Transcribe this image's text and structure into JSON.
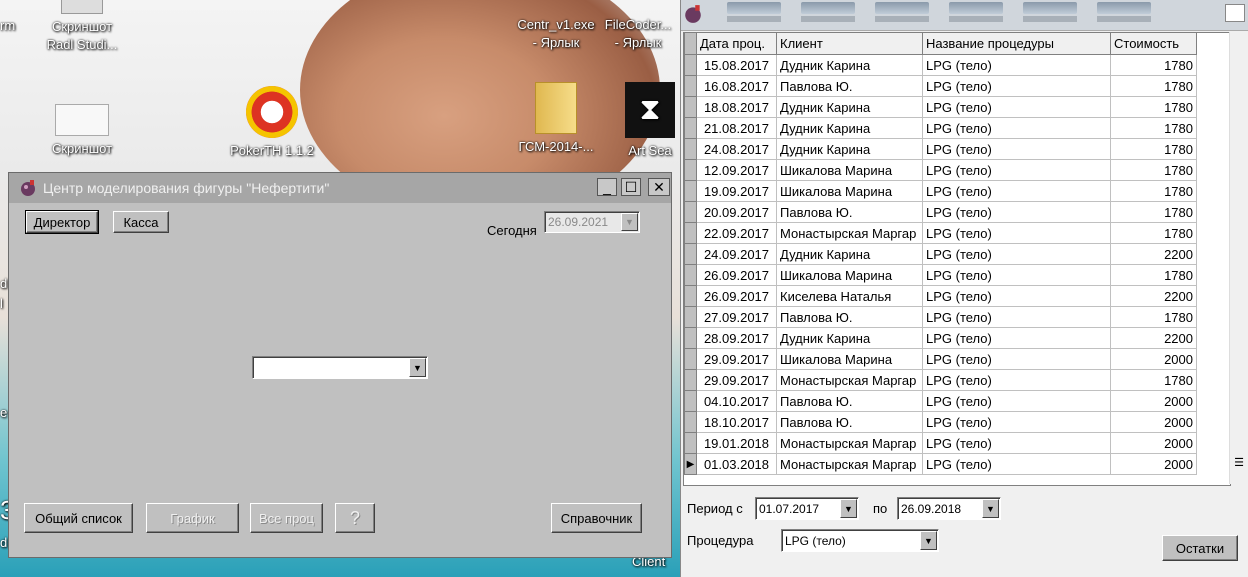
{
  "desktop": {
    "icons": [
      {
        "label": "Скриншот\nRadl Studi..."
      },
      {
        "label": "Скриншот"
      },
      {
        "label": "PokerTH 1.1.2"
      },
      {
        "label": "Centr_v1.exe\n- Ярлык"
      },
      {
        "label": "FileCoder...\n- Ярлык"
      },
      {
        "label": "ГСМ-2014-..."
      },
      {
        "label": "Art Sea"
      },
      {
        "label": "Client"
      }
    ],
    "edge_texts": [
      "rm",
      "d",
      "l",
      "3",
      "d",
      "e"
    ]
  },
  "main_window": {
    "title": "Центр моделирования фигуры \"Нефертити\"",
    "buttons": {
      "director": "Директор",
      "cash": "Касса",
      "general_list": "Общий список",
      "schedule": "График",
      "all_procs": "Все проц",
      "help": "?",
      "reference": "Справочник"
    },
    "today_label": "Сегодня",
    "today_value": "26.09.2021",
    "center_combo_value": ""
  },
  "table": {
    "headers": [
      "Дата проц.",
      "Клиент",
      "Название процедуры",
      "Стоимость"
    ],
    "rows": [
      [
        "15.08.2017",
        "Дудник Карина",
        "LPG (тело)",
        "1780"
      ],
      [
        "16.08.2017",
        "Павлова Ю.",
        "LPG (тело)",
        "1780"
      ],
      [
        "18.08.2017",
        "Дудник Карина",
        "LPG (тело)",
        "1780"
      ],
      [
        "21.08.2017",
        "Дудник Карина",
        "LPG (тело)",
        "1780"
      ],
      [
        "24.08.2017",
        "Дудник Карина",
        "LPG (тело)",
        "1780"
      ],
      [
        "12.09.2017",
        "Шикалова Марина",
        "LPG (тело)",
        "1780"
      ],
      [
        "19.09.2017",
        "Шикалова Марина",
        "LPG (тело)",
        "1780"
      ],
      [
        "20.09.2017",
        "Павлова Ю.",
        "LPG (тело)",
        "1780"
      ],
      [
        "22.09.2017",
        "Монастырская Маргар",
        "LPG (тело)",
        "1780"
      ],
      [
        "24.09.2017",
        "Дудник Карина",
        "LPG (тело)",
        "2200"
      ],
      [
        "26.09.2017",
        "Шикалова Марина",
        "LPG (тело)",
        "1780"
      ],
      [
        "26.09.2017",
        "Киселева Наталья",
        "LPG (тело)",
        "2200"
      ],
      [
        "27.09.2017",
        "Павлова Ю.",
        "LPG (тело)",
        "1780"
      ],
      [
        "28.09.2017",
        "Дудник Карина",
        "LPG (тело)",
        "2200"
      ],
      [
        "29.09.2017",
        "Шикалова Марина",
        "LPG (тело)",
        "2000"
      ],
      [
        "29.09.2017",
        "Монастырская Маргар",
        "LPG (тело)",
        "1780"
      ],
      [
        "04.10.2017",
        "Павлова Ю.",
        "LPG (тело)",
        "2000"
      ],
      [
        "18.10.2017",
        "Павлова Ю.",
        "LPG (тело)",
        "2000"
      ],
      [
        "19.01.2018",
        "Монастырская Маргар",
        "LPG (тело)",
        "2000"
      ],
      [
        "01.03.2018",
        "Монастырская Маргар",
        "LPG (тело)",
        "2000"
      ]
    ],
    "current_row_index": 19
  },
  "filters": {
    "period_label": "Период с",
    "period_from": "01.07.2017",
    "to_label": "по",
    "period_to": "26.09.2018",
    "procedure_label": "Процедура",
    "procedure_value": "LPG (тело)",
    "remainders_button": "Остатки"
  }
}
